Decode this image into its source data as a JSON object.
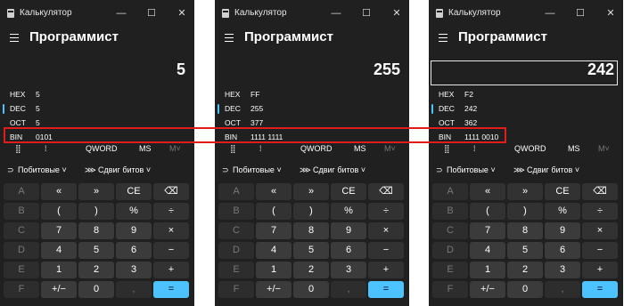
{
  "app_title": "Калькулятор",
  "mode": "Программист",
  "controls": {
    "minimize": "—",
    "maximize": "☐",
    "close": "✕"
  },
  "toolbar": {
    "word_size": "QWORD",
    "ms": "MS",
    "mem": "M˅"
  },
  "secondary": {
    "bitwise": "Побитовые ˅",
    "bitshift": "Сдвиг битов ˅"
  },
  "radix_labels": {
    "hex": "HEX",
    "dec": "DEC",
    "oct": "OCT",
    "bin": "BIN"
  },
  "keys": [
    "A",
    "«",
    "»",
    "CE",
    "⌫",
    "B",
    "(",
    ")",
    "%",
    "÷",
    "C",
    "7",
    "8",
    "9",
    "×",
    "D",
    "4",
    "5",
    "6",
    "−",
    "E",
    "1",
    "2",
    "3",
    "+",
    "F",
    "+/−",
    "0",
    ",",
    "="
  ],
  "windows": [
    {
      "display": "5",
      "hex": "5",
      "dec": "5",
      "oct": "5",
      "bin": "0101"
    },
    {
      "display": "255",
      "hex": "FF",
      "dec": "255",
      "oct": "377",
      "bin": "1111 1111"
    },
    {
      "display": "242",
      "hex": "F2",
      "dec": "242",
      "oct": "362",
      "bin": "1111 0010"
    }
  ],
  "accent_color": "#4cc2ff",
  "highlight_color": "#e01c1c"
}
